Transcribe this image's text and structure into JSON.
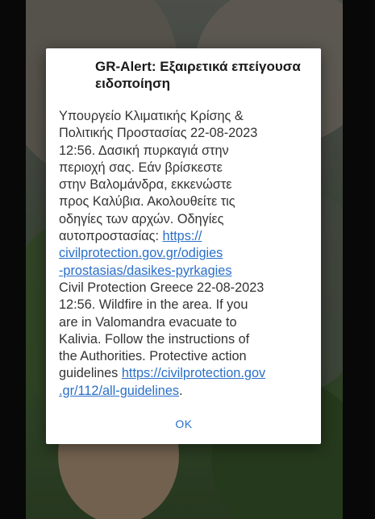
{
  "dialog": {
    "title": "GR-Alert: Εξαιρετικά επείγουσα ειδοποίηση",
    "message_lines": [
      "Υπουργείο Κλιματικής Κρίσης &",
      "Πολιτικής Προστασίας 22-08-2023",
      "12:56. Δασική πυρκαγιά στην",
      "περιοχή σας. Εάν βρίσκεστε",
      "στην Βαλομάνδρα, εκκενώστε",
      "προς Καλύβια. Ακολουθείτε τις",
      "οδηγίες των αρχών. Οδηγίες"
    ],
    "greek_guidelines_prefix": "αυτοπροστασίας: ",
    "greek_link_lines": [
      "https://",
      "civilprotection.gov.gr/odigies",
      "-prostasias/dasikes-pyrkagies"
    ],
    "english_lines": [
      "Civil Protection Greece 22-08-2023",
      "12:56. Wildfire in the area. If you",
      "are in Valomandra evacuate to",
      "Kalivia. Follow the instructions of",
      "the Authorities. Protective action"
    ],
    "english_guidelines_prefix": "guidelines ",
    "english_link_lines": [
      "https://civilprotection.gov",
      ".gr/112/all-guidelines"
    ],
    "english_link_suffix": ".",
    "ok_label": "OK"
  },
  "colors": {
    "link": "#2a6fc9",
    "dialog_background": "#ffffff",
    "title_text": "#1a1a1a",
    "body_text": "#333333"
  }
}
